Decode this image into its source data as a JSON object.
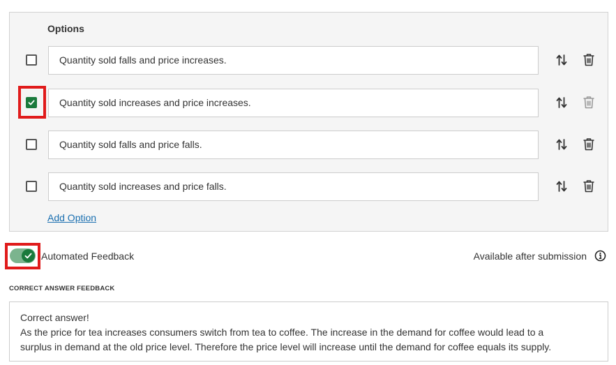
{
  "options_section": {
    "heading": "Options",
    "items": [
      {
        "text": "Quantity sold falls and price increases.",
        "checked": false,
        "delete_enabled": true
      },
      {
        "text": "Quantity sold increases and price increases.",
        "checked": true,
        "delete_enabled": false
      },
      {
        "text": "Quantity sold falls and price falls.",
        "checked": false,
        "delete_enabled": true
      },
      {
        "text": "Quantity sold increases and price falls.",
        "checked": false,
        "delete_enabled": true
      }
    ],
    "add_option_label": "Add Option"
  },
  "automated_feedback": {
    "enabled": true,
    "label": "Automated Feedback",
    "availability_text": "Available after submission"
  },
  "correct_answer_feedback": {
    "heading": "CORRECT ANSWER FEEDBACK",
    "lines": [
      "Correct answer!",
      "As the price for tea increases consumers switch from tea to coffee. The increase in the demand for coffee would lead to a",
      "surplus in demand at the old price level. Therefore the price level will increase until the demand for coffee equals its supply."
    ]
  },
  "colors": {
    "accent_green": "#1a7a3c",
    "toggle_track": "#7bb48e",
    "highlight_red": "#e01b1b",
    "link_blue": "#1a6fb0"
  },
  "icons": {
    "reorder": "reorder-arrows-icon",
    "delete": "trash-icon",
    "info": "info-icon",
    "check": "check-icon"
  }
}
